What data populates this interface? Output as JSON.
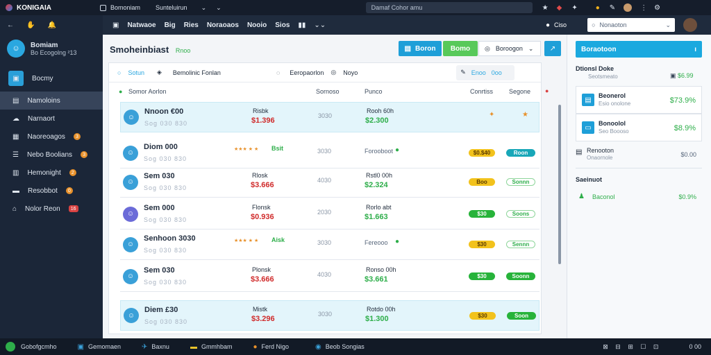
{
  "app_title": "KONIGAIA",
  "topbar": {
    "tabs": [
      "Bomoniam",
      "Sunteluirun"
    ],
    "address": "Damaf Cohor amu",
    "icons": [
      "back-arrow-icon",
      "home-icon",
      "bell-icon",
      "search-icon",
      "star-icon",
      "tag-icon",
      "grid-icon",
      "profile-icon",
      "more-icon"
    ]
  },
  "sidebar": {
    "profile_name": "Bomiam",
    "profile_sub": "Bo Ecogolng ²13",
    "items": [
      {
        "label": "Bocmy",
        "icon": "box-icon",
        "badge": ""
      },
      {
        "label": "Namoloins",
        "icon": "document-icon",
        "badge": ""
      },
      {
        "label": "Narnaort",
        "icon": "cloud-icon",
        "badge": ""
      },
      {
        "label": "Naoreoagos",
        "icon": "chart-icon",
        "badge": "3"
      },
      {
        "label": "Nebo Boolians",
        "icon": "list-icon",
        "badge": "3"
      },
      {
        "label": "Hemonight",
        "icon": "calendar-icon",
        "badge": "2"
      },
      {
        "label": "Resobbot",
        "icon": "folder-icon",
        "badge": "0"
      },
      {
        "label": "Nolor Reon",
        "icon": "home-icon",
        "badge": "16"
      }
    ]
  },
  "navbar": {
    "items": [
      "Natwaoe",
      "Big",
      "Ries",
      "Noraoaos",
      "Nooio",
      "Sios"
    ]
  },
  "rightbar": {
    "label": "Ciso",
    "search_placeholder": "Nonaoton"
  },
  "main": {
    "title": "Smoheinbiast",
    "title_tag": "Rnoo",
    "primary_button": "Boron",
    "secondary_button": "Bomo",
    "select_value": "Boroogon",
    "filters": {
      "search_value": "Sotun",
      "filter_a": "Bemolinic Fonlan",
      "filter_b": "Eeropaorlon",
      "filter_c": "Noyo",
      "action": "Enoo",
      "action_count": "0oo"
    },
    "headers": {
      "name": "Somor Aorlon",
      "status": "Sornoso",
      "date": "Punco",
      "priority": "Conrtiss",
      "stage": "Segone"
    },
    "rows": [
      {
        "name": "Nnoon €00",
        "sub": "Sog 030 830",
        "label": "Risbk",
        "amount": "$1.396",
        "amount_color": "red",
        "code": "3030",
        "meta": "Rooh 60h",
        "meta_amount": "$2.300",
        "badge": "",
        "badge_color": "",
        "status": "",
        "status_color": "",
        "highlight": true,
        "stars": "",
        "rating": ""
      },
      {
        "name": "Diom 000",
        "sub": "Sog 030 830",
        "label": "",
        "amount": "",
        "amount_color": "",
        "code": "3030",
        "meta": "Forooboot",
        "meta_amount": "",
        "badge": "$0.$40",
        "badge_color": "orange",
        "status": "Roon",
        "status_color": "teal",
        "highlight": false,
        "stars": "★★★ ★ ★",
        "rating": "Bsit"
      },
      {
        "name": "Sem 030",
        "sub": "Sog 030 830",
        "label": "Rlosk",
        "amount": "$3.666",
        "amount_color": "red",
        "code": "4030",
        "meta": "Rstl0 00h",
        "meta_amount": "$2.324",
        "badge": "Boo",
        "badge_color": "orange",
        "status": "Sonnn",
        "status_color": "outline",
        "highlight": false,
        "stars": "",
        "rating": ""
      },
      {
        "name": "Sem 000",
        "sub": "Sog 030 830",
        "label": "Flonsk",
        "amount": "$0.936",
        "amount_color": "red",
        "code": "2030",
        "meta": "Rorlo abt",
        "meta_amount": "$1.663",
        "badge": "$30",
        "badge_color": "green",
        "status": "Soons",
        "status_color": "outline",
        "highlight": false,
        "stars": "",
        "rating": ""
      },
      {
        "name": "Senhoon 3030",
        "sub": "Sog 030 830",
        "label": "",
        "amount": "",
        "amount_color": "",
        "code": "3030",
        "meta": "Fereooo",
        "meta_amount": "",
        "badge": "$30",
        "badge_color": "orange",
        "status": "Sennn",
        "status_color": "outline",
        "highlight": false,
        "stars": "★★★ ★ ★",
        "rating": "Aisk"
      },
      {
        "name": "Sem 030",
        "sub": "Sog 030 830",
        "label": "Plonsk",
        "amount": "$3.666",
        "amount_color": "red",
        "code": "4030",
        "meta": "Ronso 00h",
        "meta_amount": "$3.661",
        "badge": "$30",
        "badge_color": "green",
        "status": "Soonn",
        "status_color": "green",
        "highlight": false,
        "stars": "",
        "rating": ""
      },
      {
        "name": "Diem £30",
        "sub": "Sog 030 830",
        "label": "Mistk",
        "amount": "$3.296",
        "amount_color": "red",
        "code": "3030",
        "meta": "Rotdo 00h",
        "meta_amount": "$1.300",
        "badge": "$30",
        "badge_color": "orange",
        "status": "Soon",
        "status_color": "green",
        "highlight": true,
        "stars": "",
        "rating": ""
      }
    ]
  },
  "right": {
    "header_button": "Boraotoon",
    "section_title": "Dtionsl Doke",
    "section_sub": "Seotsmeato",
    "section_amount": "$6.99",
    "cards": [
      {
        "title": "Beonerol",
        "sub": "Esio onolone",
        "amount": "$73.9%"
      },
      {
        "title": "Bonoolol",
        "sub": "Seo Boooso",
        "amount": "$8.9%"
      }
    ],
    "extra_title": "Renooton",
    "extra_sub": "Onaornole",
    "extra_amount": "$0.00",
    "summary_title": "Saeinuot",
    "summary_label": "Baconol",
    "summary_amount": "$0.9%"
  },
  "taskbar": {
    "items": [
      "Gobofgcmho",
      "Gemomaen",
      "Baxnu",
      "Gmmhbam",
      "Ferd Nigo",
      "Beob Songias"
    ],
    "tray": "0 00"
  }
}
